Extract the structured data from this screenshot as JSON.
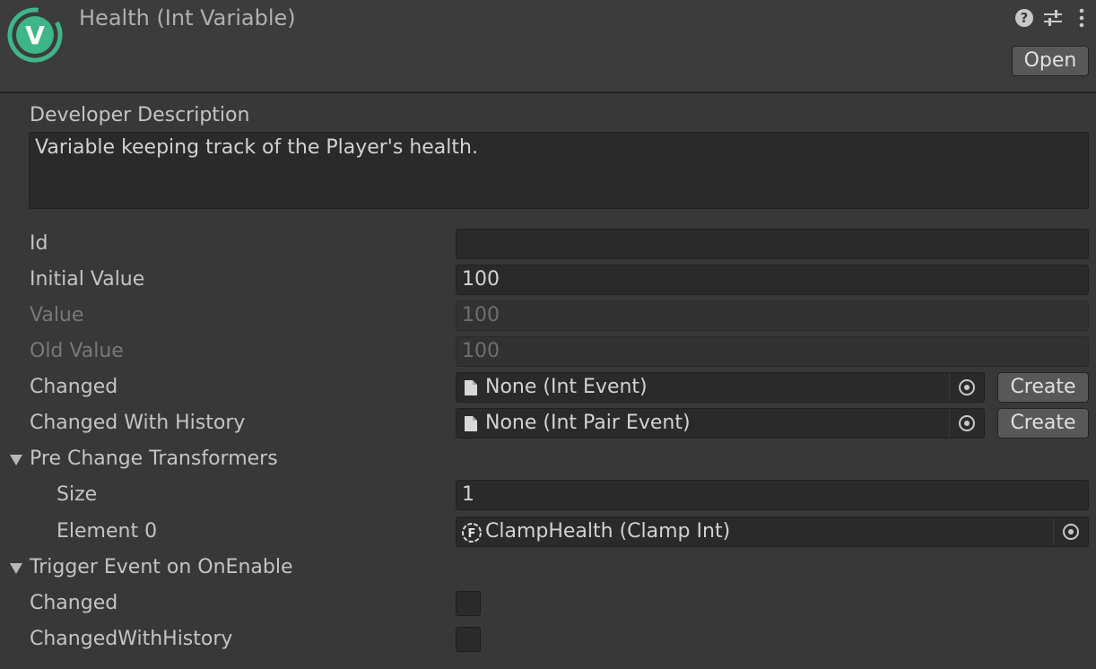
{
  "header": {
    "title": "Health (Int Variable)",
    "logo_letter": "V",
    "open_label": "Open",
    "icons": [
      "help-icon",
      "preset-sliders-icon",
      "more-vertical-icon"
    ]
  },
  "description": {
    "label": "Developer Description",
    "value": "Variable keeping track of the Player's health."
  },
  "fields": {
    "id": {
      "label": "Id",
      "value": ""
    },
    "initial_value": {
      "label": "Initial Value",
      "value": "100"
    },
    "value": {
      "label": "Value",
      "value": "100"
    },
    "old_value": {
      "label": "Old Value",
      "value": "100"
    },
    "changed": {
      "label": "Changed",
      "value": "None (Int Event)",
      "create_label": "Create"
    },
    "changed_with_history": {
      "label": "Changed With History",
      "value": "None (Int Pair Event)",
      "create_label": "Create"
    }
  },
  "pre_change": {
    "label": "Pre Change Transformers",
    "size_label": "Size",
    "size_value": "1",
    "element0_label": "Element 0",
    "element0_value": "ClampHealth (Clamp Int)",
    "element0_icon_letter": "F"
  },
  "trigger": {
    "label": "Trigger Event on OnEnable",
    "changed_label": "Changed",
    "changed_checked": false,
    "changed_with_history_label": "ChangedWithHistory",
    "changed_with_history_checked": false
  },
  "colors": {
    "accent_logo": "#3fb58a",
    "background": "#383838",
    "field": "#2a2a2a",
    "button": "#585858"
  }
}
